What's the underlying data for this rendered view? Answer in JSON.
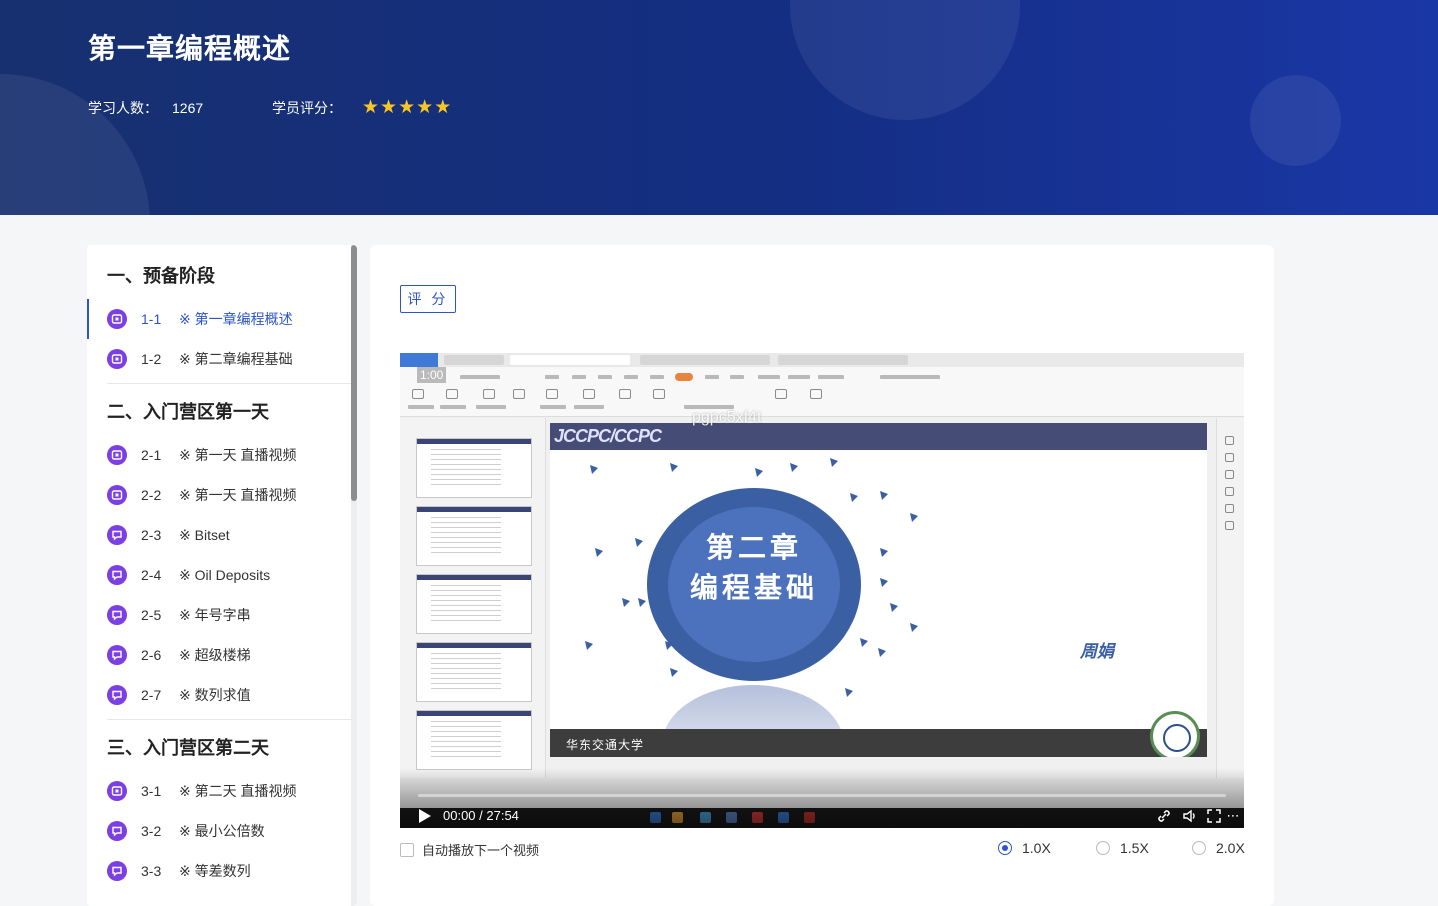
{
  "header": {
    "title": "第一章编程概述",
    "learners_label": "学习人数：",
    "learners_count": "1267",
    "rating_label": "学员评分：",
    "rating_stars": 5,
    "accent_color": "#f7c623"
  },
  "sidebar": {
    "sections": [
      {
        "title": "一、预备阶段",
        "items": [
          {
            "code": "1-1",
            "name": "※ 第一章编程概述",
            "icon": "video-icon",
            "active": true
          },
          {
            "code": "1-2",
            "name": "※ 第二章编程基础",
            "icon": "video-icon",
            "active": false
          }
        ]
      },
      {
        "title": "二、入门营区第一天",
        "items": [
          {
            "code": "2-1",
            "name": "※ 第一天 直播视频",
            "icon": "video-icon",
            "active": false
          },
          {
            "code": "2-2",
            "name": "※ 第一天 直播视频",
            "icon": "video-icon",
            "active": false
          },
          {
            "code": "2-3",
            "name": "※ Bitset",
            "icon": "exercise-icon",
            "active": false
          },
          {
            "code": "2-4",
            "name": "※ Oil Deposits",
            "icon": "exercise-icon",
            "active": false
          },
          {
            "code": "2-5",
            "name": "※ 年号字串",
            "icon": "exercise-icon",
            "active": false
          },
          {
            "code": "2-6",
            "name": "※ 超级楼梯",
            "icon": "exercise-icon",
            "active": false
          },
          {
            "code": "2-7",
            "name": "※ 数列求值",
            "icon": "exercise-icon",
            "active": false
          }
        ]
      },
      {
        "title": "三、入门营区第二天",
        "items": [
          {
            "code": "3-1",
            "name": "※ 第二天 直播视频",
            "icon": "video-icon",
            "active": false
          },
          {
            "code": "3-2",
            "name": "※ 最小公倍数",
            "icon": "exercise-icon",
            "active": false
          },
          {
            "code": "3-3",
            "name": "※ 等差数列",
            "icon": "exercise-icon",
            "active": false
          }
        ]
      }
    ],
    "active_color": "#2c55c9",
    "badge_color": "#7b3fe4"
  },
  "main": {
    "rate_button": "评 分",
    "video": {
      "overlay_time": "1:00",
      "watermark": "pgpc5xf4t",
      "slide_logo": "JCCPC/CCPC",
      "slide_chapter_line1": "第二章",
      "slide_chapter_line2": "编程基础",
      "slide_author": "周娟",
      "slide_university": "华东交通大学",
      "time_display": "00:00 / 27:54"
    },
    "autoplay_label": "自动播放下一个视频",
    "speeds": [
      {
        "label": "1.0X",
        "checked": true
      },
      {
        "label": "1.5X",
        "checked": false
      },
      {
        "label": "2.0X",
        "checked": false
      }
    ]
  }
}
